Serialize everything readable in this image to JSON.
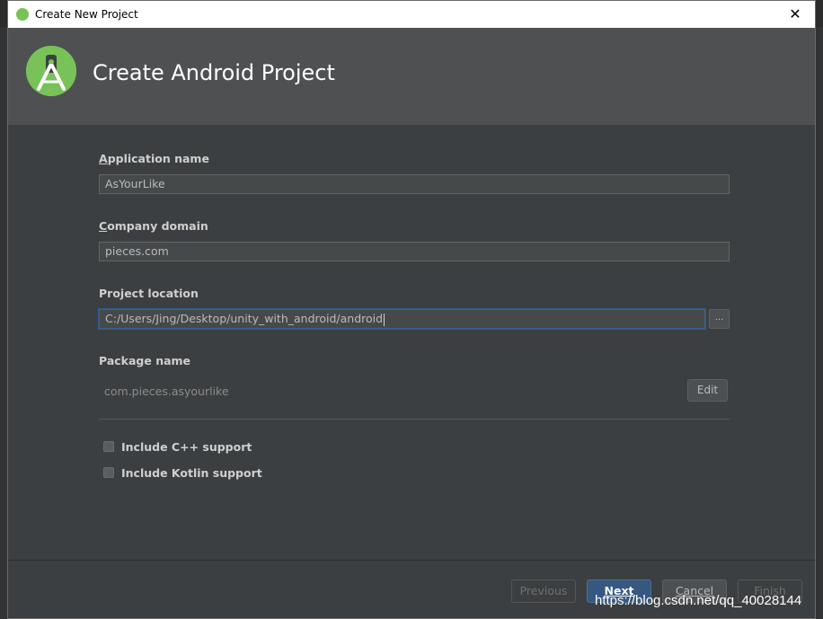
{
  "window": {
    "title": "Create New Project",
    "close_glyph": "✕"
  },
  "header": {
    "title": "Create Android Project",
    "logo_icon": "android-studio-logo-icon"
  },
  "form": {
    "app_name": {
      "label_underlined": "A",
      "label_rest": "pplication name",
      "value": "AsYourLike"
    },
    "company_domain": {
      "label_underlined": "C",
      "label_rest": "ompany domain",
      "value": "pieces.com"
    },
    "project_location": {
      "label": "Project location",
      "value": "C:/Users/Jing/Desktop/unity_with_android/android",
      "browse_label": "..."
    },
    "package_name": {
      "label": "Package name",
      "value": "com.pieces.asyourlike",
      "edit_label": "Edit"
    },
    "include_cpp": {
      "label": "Include C++ support",
      "checked": false
    },
    "include_kotlin": {
      "label": "Include Kotlin support",
      "checked": false
    }
  },
  "footer": {
    "previous": "Previous",
    "next": "Next",
    "cancel": "Cancel",
    "finish": "Finish"
  },
  "watermark": "https://blog.csdn.net/qq_40028144",
  "colors": {
    "background": "#3c3f41",
    "header": "#4e5052",
    "primary_button": "#365880",
    "logo": "#78c257"
  }
}
